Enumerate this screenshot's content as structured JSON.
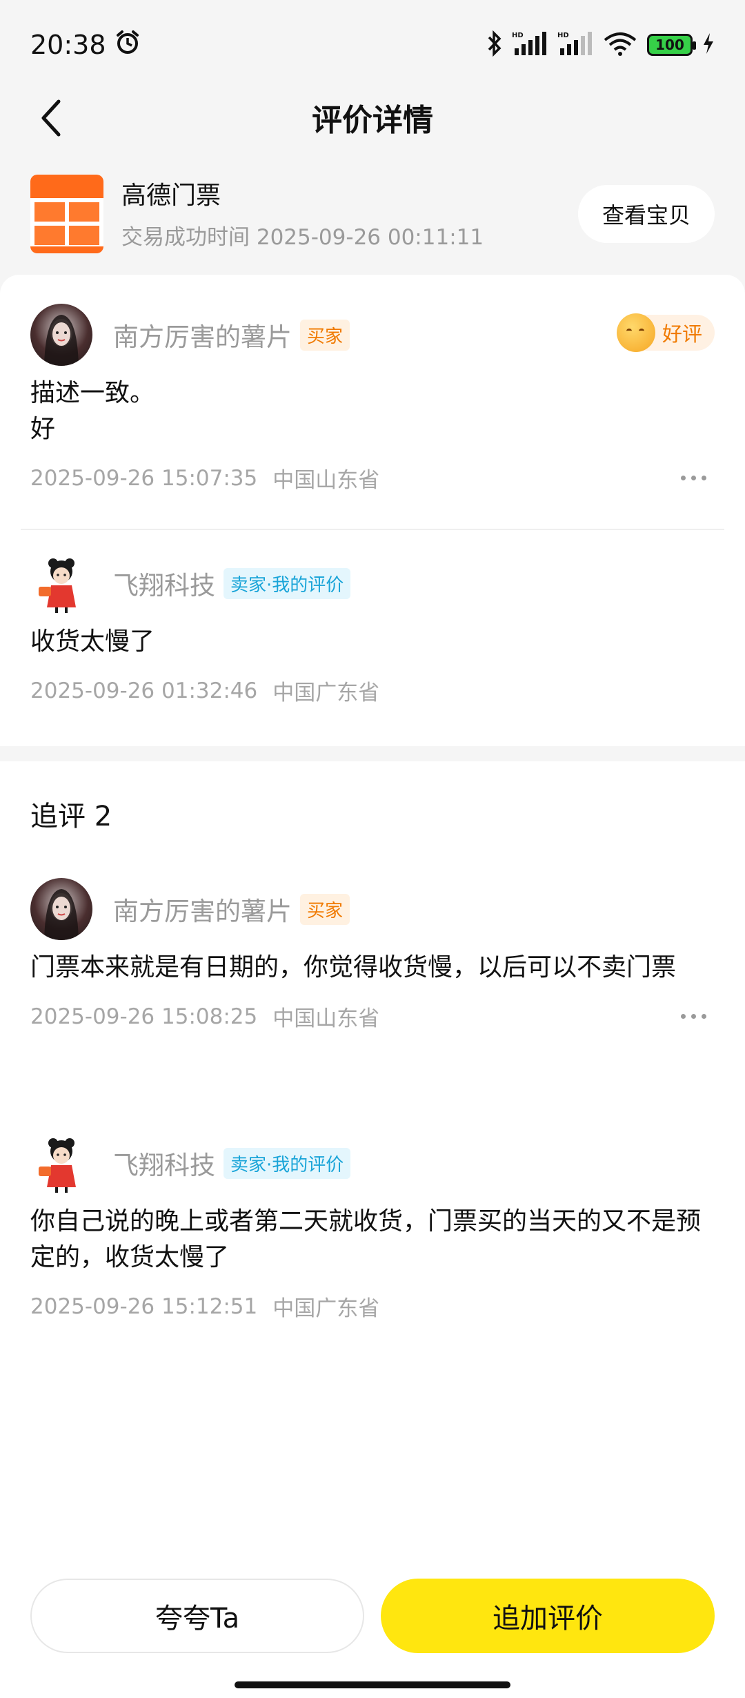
{
  "status_bar": {
    "time": "20:38",
    "battery": "100",
    "icons": [
      "alarm-icon",
      "bluetooth-icon",
      "signal-hd-icon",
      "signal-hd-icon",
      "wifi-icon",
      "battery-icon",
      "charging-icon"
    ]
  },
  "header": {
    "title": "评价详情",
    "back_icon": "chevron-left-icon"
  },
  "product": {
    "name": "高德门票",
    "time": "交易成功时间 2025-09-26 00:11:11",
    "view_button": "查看宝贝"
  },
  "comments": [
    {
      "nick": "南方厉害的薯片",
      "tag": "买家",
      "rating": "好评",
      "body": "描述一致。\n好",
      "time": "2025-09-26 15:07:35",
      "location": "中国山东省"
    },
    {
      "nick": "飞翔科技",
      "tag": "卖家·我的评价",
      "body": "收货太慢了",
      "time": "2025-09-26 01:32:46",
      "location": "中国广东省"
    }
  ],
  "followups": {
    "title": "追评 2",
    "items": [
      {
        "nick": "南方厉害的薯片",
        "tag": "买家",
        "body": "门票本来就是有日期的，你觉得收货慢，以后可以不卖门票",
        "time": "2025-09-26 15:08:25",
        "location": "中国山东省"
      },
      {
        "nick": "飞翔科技",
        "tag": "卖家·我的评价",
        "body": "你自己说的晚上或者第二天就收货，门票买的当天的又不是预定的，收货太慢了",
        "time": "2025-09-26 15:12:51",
        "location": "中国广东省"
      }
    ]
  },
  "bottom": {
    "praise_button": "夸夸Ta",
    "append_button": "追加评价"
  },
  "colors": {
    "accent_yellow": "#ffe60f",
    "buyer_tag": "#f07a00",
    "seller_tag": "#19a4d8"
  }
}
